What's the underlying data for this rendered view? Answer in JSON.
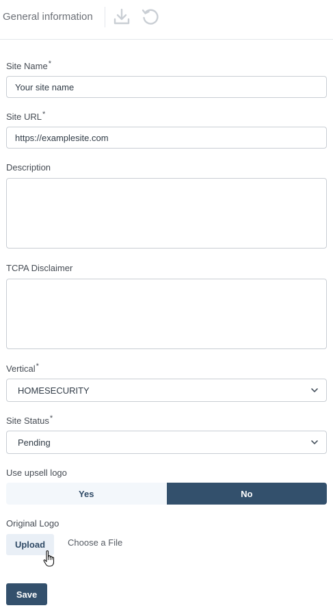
{
  "header": {
    "title": "General information",
    "download_icon": "download-icon",
    "reset_icon": "reset-icon"
  },
  "form": {
    "site_name": {
      "label": "Site Name",
      "required": "*",
      "value": "Your site name"
    },
    "site_url": {
      "label": "Site URL",
      "required": "*",
      "value": "https://examplesite.com"
    },
    "description": {
      "label": "Description",
      "value": ""
    },
    "tcpa": {
      "label": "TCPA Disclaimer",
      "value": ""
    },
    "vertical": {
      "label": "Vertical",
      "required": "*",
      "selected": "HOMESECURITY"
    },
    "site_status": {
      "label": "Site Status",
      "required": "*",
      "selected": "Pending"
    },
    "upsell_logo": {
      "label": "Use upsell logo",
      "yes": "Yes",
      "no": "No",
      "selected": "No"
    },
    "original_logo": {
      "label": "Original Logo",
      "upload_label": "Upload",
      "file_text": "Choose a File"
    },
    "save_label": "Save"
  },
  "colors": {
    "primary": "#33506c",
    "toggle_inactive_bg": "#f3f7fb",
    "upload_bg": "#e9eff6",
    "border": "#c8cdd3"
  }
}
